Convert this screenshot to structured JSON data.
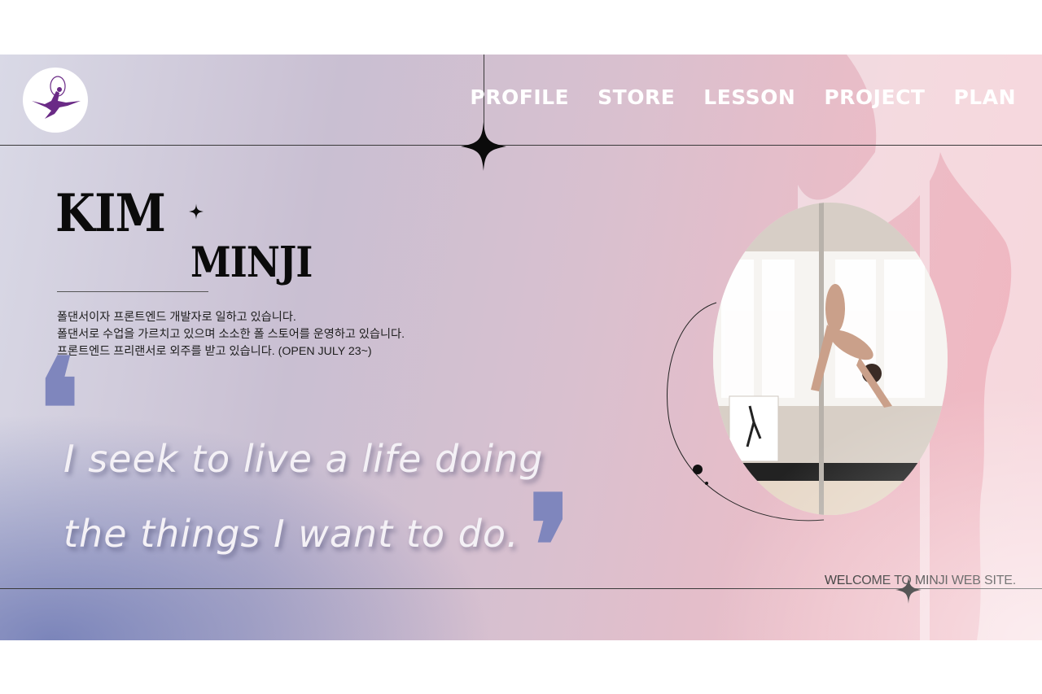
{
  "brand": {
    "logo_icon": "aerial-dancer-icon"
  },
  "nav": {
    "items": [
      {
        "label": "PROFILE"
      },
      {
        "label": "STORE"
      },
      {
        "label": "LESSON"
      },
      {
        "label": "PROJECT"
      },
      {
        "label": "PLAN"
      }
    ]
  },
  "hero": {
    "first_name": "KIM",
    "last_name": "MINJI",
    "intro": [
      "폴댄서이자 프론트엔드 개발자로 일하고 있습니다.",
      "폴댄서로 수업을 가르치고 있으며 소소한 폴 스토어를 운영하고 있습니다.",
      "프론트엔드 프리랜서로 외주를 받고 있습니다. (OPEN JULY 23~)"
    ]
  },
  "quote": {
    "open_mark": "❛",
    "close_mark": "❜",
    "line1": "I seek to live a life doing",
    "line2": "the things I want to do."
  },
  "photo": {
    "subject": "pole-dance-photo"
  },
  "footer": {
    "welcome": "WELCOME TO MINJI WEB SITE."
  },
  "colors": {
    "gradient_left": "#d9d9e6",
    "gradient_right": "#f2b6c0",
    "accent_blue": "#7f86bd",
    "logo_purple": "#6a2a86"
  }
}
